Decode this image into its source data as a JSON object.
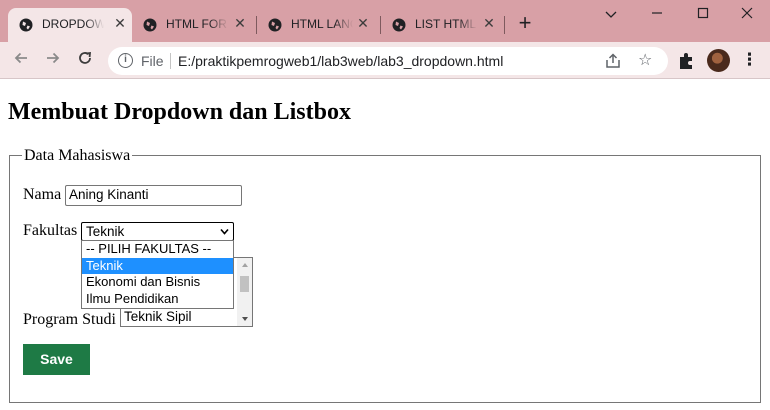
{
  "browser": {
    "tabs": [
      {
        "title": "DROPDOWN",
        "active": true
      },
      {
        "title": "HTML FORM",
        "active": false
      },
      {
        "title": "HTML LANG",
        "active": false
      },
      {
        "title": "LIST HTML",
        "active": false
      }
    ],
    "new_tab_symbol": "+",
    "window_controls": {
      "minimize": "—",
      "restore": "☐",
      "close": "✕",
      "tab_search": "⌄"
    },
    "address_bar": {
      "scheme_label": "File",
      "url": "E:/praktikpemrogweb1/lab3web/lab3_dropdown.html"
    },
    "icons": [
      "back-icon",
      "forward-icon",
      "reload-icon",
      "info-icon",
      "share-icon",
      "star-icon",
      "extensions-icon",
      "avatar",
      "menu-icon"
    ]
  },
  "page": {
    "title": "Membuat Dropdown dan Listbox",
    "fieldset_legend": "Data Mahasiswa",
    "nama": {
      "label": "Nama",
      "value": "Aning Kinanti"
    },
    "fakultas": {
      "label": "Fakultas",
      "selected": "Teknik",
      "options": [
        "-- PILIH FAKULTAS --",
        "Teknik",
        "Ekonomi dan Bisnis",
        "Ilmu Pendidikan"
      ]
    },
    "program_studi": {
      "label": "Program Studi",
      "visible_option": "Teknik Sipil"
    },
    "save_button": "Save"
  },
  "colors": {
    "tabstrip": "#d8a0a6",
    "toolbar": "#f4e6e7",
    "save_button": "#1e7a45",
    "option_highlight": "#1e90ff"
  }
}
